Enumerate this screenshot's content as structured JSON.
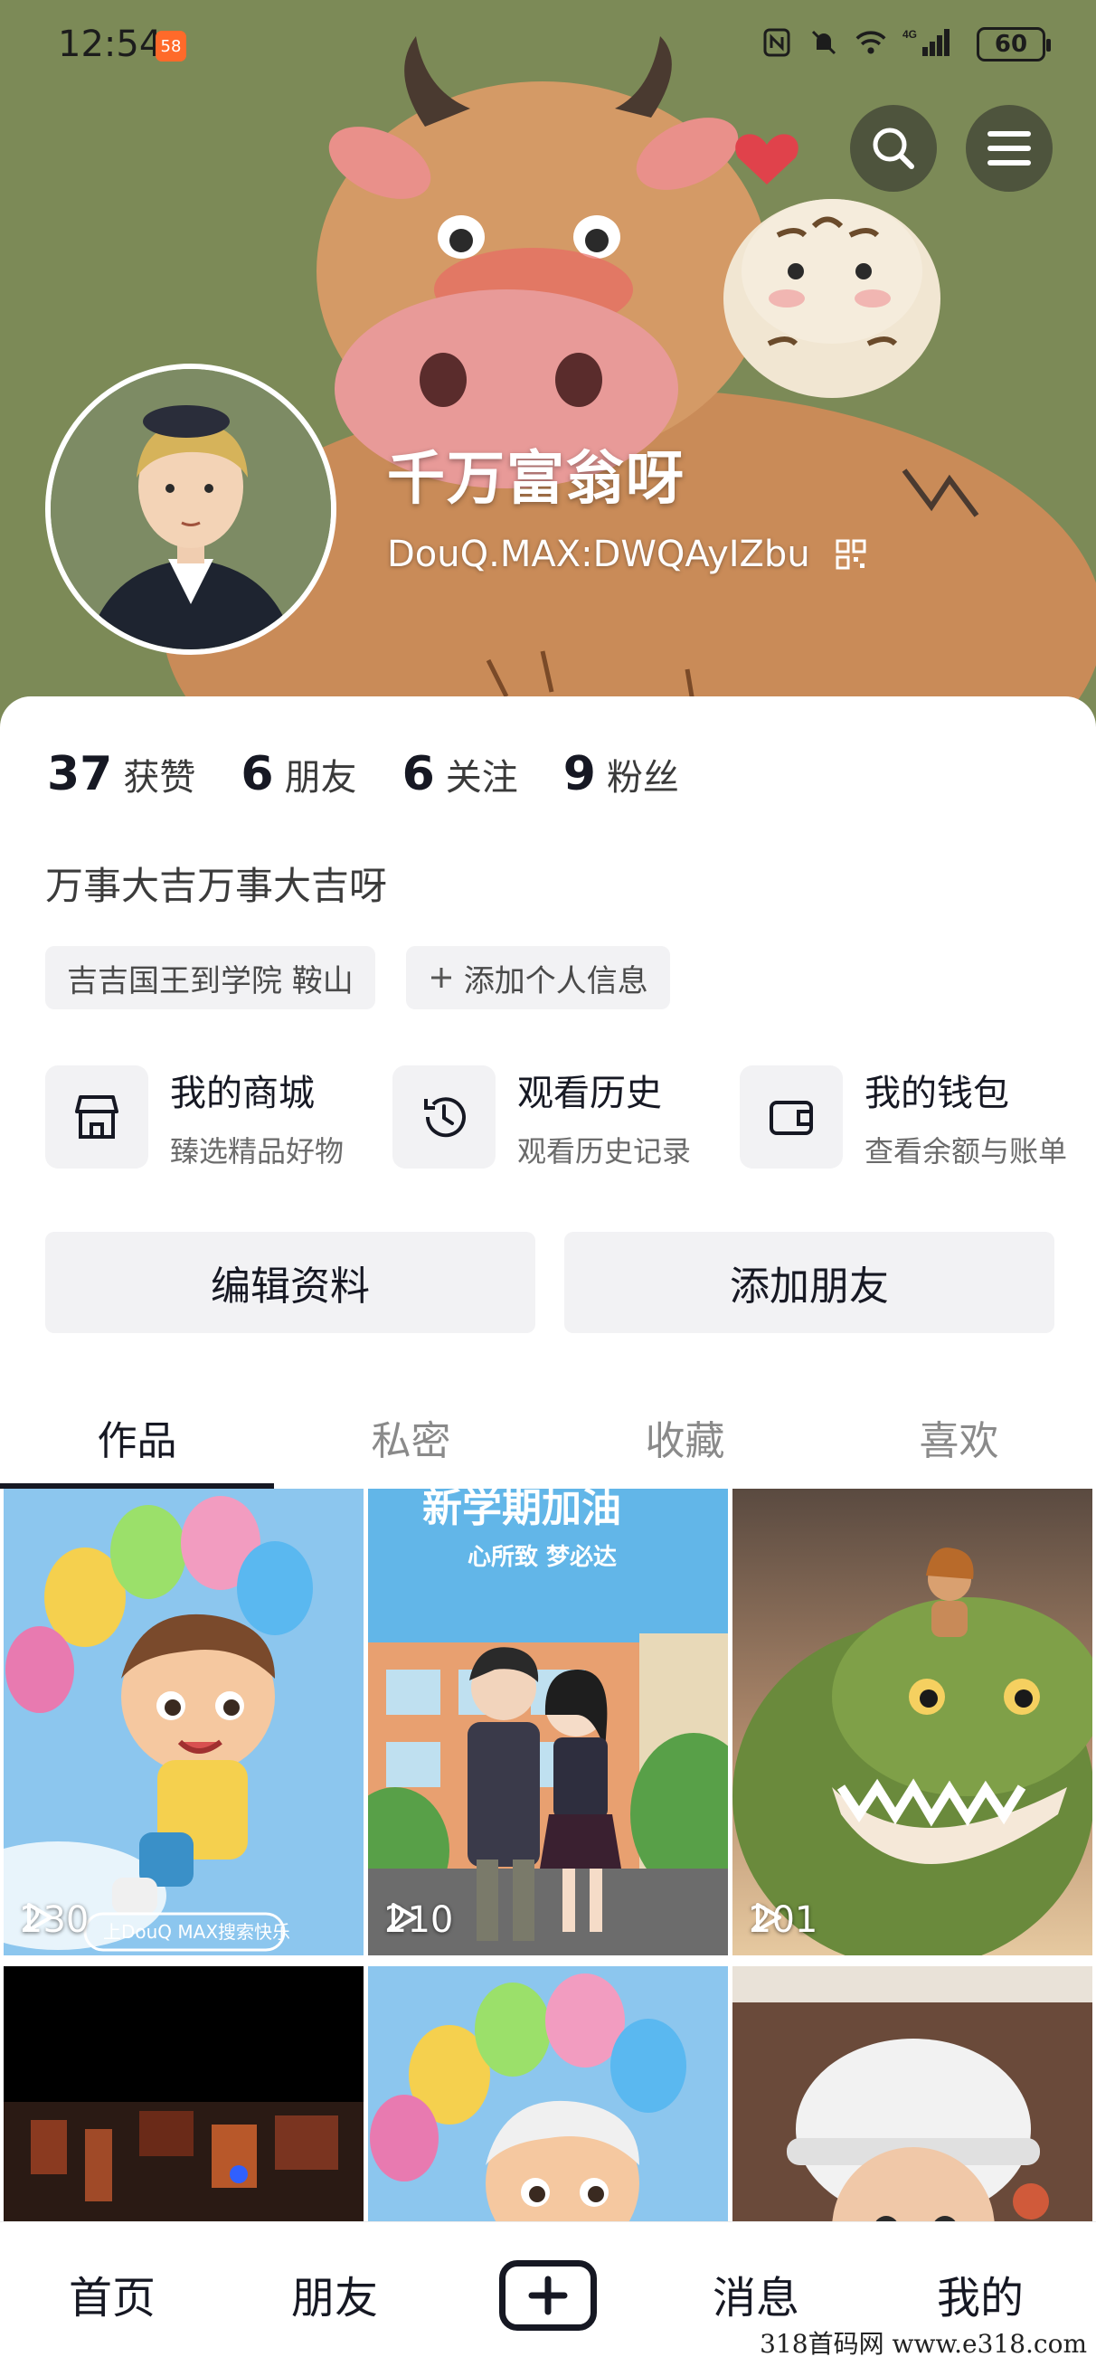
{
  "status_bar": {
    "time": "12:54",
    "app_badge": "58",
    "network": "4G",
    "battery": "60"
  },
  "header": {
    "search_icon": "search-icon",
    "menu_icon": "menu-icon"
  },
  "profile": {
    "nickname": "千万富翁呀",
    "account_id": "DouQ.MAX:DWQAyIZbu",
    "bio": "万事大吉万事大吉呀"
  },
  "stats": [
    {
      "value": "37",
      "label": "获赞"
    },
    {
      "value": "6",
      "label": "朋友"
    },
    {
      "value": "6",
      "label": "关注"
    },
    {
      "value": "9",
      "label": "粉丝"
    }
  ],
  "tags": {
    "location": "吉吉国王到学院 鞍山",
    "add_info": "添加个人信息"
  },
  "services": [
    {
      "title": "我的商城",
      "subtitle": "臻选精品好物",
      "icon": "store-icon"
    },
    {
      "title": "观看历史",
      "subtitle": "观看历史记录",
      "icon": "history-icon"
    },
    {
      "title": "我的钱包",
      "subtitle": "查看余额与账单",
      "icon": "wallet-icon"
    }
  ],
  "actions": {
    "edit_profile": "编辑资料",
    "add_friends": "添加朋友"
  },
  "tabs": [
    {
      "label": "作品",
      "active": true
    },
    {
      "label": "私密",
      "active": false
    },
    {
      "label": "收藏",
      "active": false
    },
    {
      "label": "喜欢",
      "active": false
    }
  ],
  "videos": [
    {
      "plays": "230",
      "overlay_text": "上DouQ MAX搜索快乐"
    },
    {
      "plays": "210",
      "overlay_text": "新学期加油",
      "sub_text": "心所致 梦必达"
    },
    {
      "plays": "201"
    },
    {
      "plays": ""
    },
    {
      "plays": ""
    },
    {
      "plays": ""
    }
  ],
  "bottom_nav": {
    "home": "首页",
    "friends": "朋友",
    "messages": "消息",
    "me": "我的"
  },
  "watermark": "318首码网 www.e318.com",
  "colors": {
    "banner_bg": "#7c8a57",
    "text_primary": "#161823",
    "chip_bg": "#f2f2f4",
    "badge_orange": "#ff6a2a"
  }
}
